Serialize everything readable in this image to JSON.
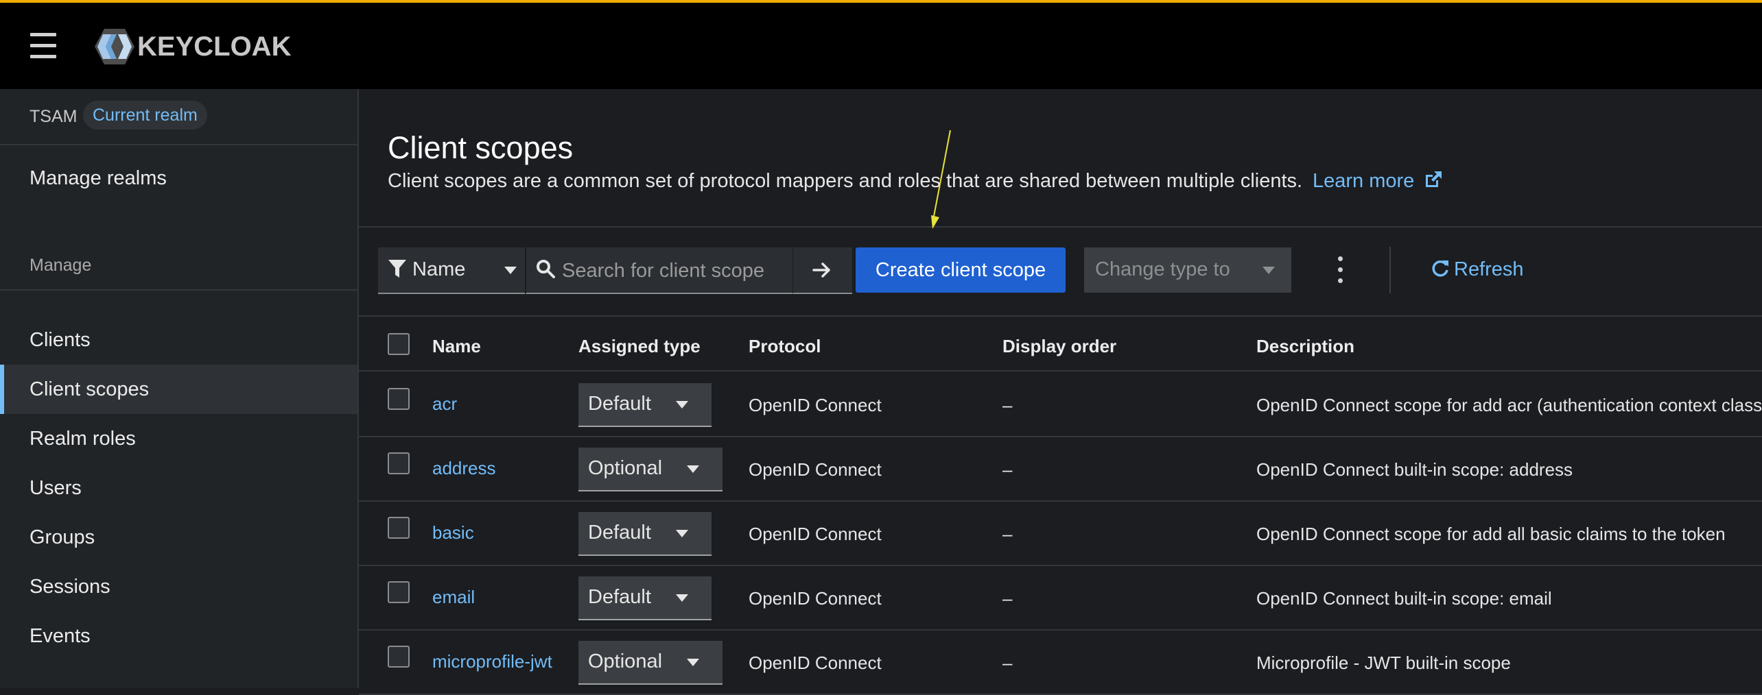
{
  "masthead": {
    "logo_text": "KEYCLOAK",
    "accent_color": "#f0ab00"
  },
  "sidebar": {
    "realm_name": "TSAM",
    "realm_badge": "Current realm",
    "manage_realms": "Manage realms",
    "section_label": "Manage",
    "items": [
      {
        "label": "Clients",
        "active": false
      },
      {
        "label": "Client scopes",
        "active": true
      },
      {
        "label": "Realm roles",
        "active": false
      },
      {
        "label": "Users",
        "active": false
      },
      {
        "label": "Groups",
        "active": false
      },
      {
        "label": "Sessions",
        "active": false
      },
      {
        "label": "Events",
        "active": false
      }
    ]
  },
  "page": {
    "title": "Client scopes",
    "description": "Client scopes are a common set of protocol mappers and roles that are shared between multiple clients.",
    "learn_more": "Learn more"
  },
  "toolbar": {
    "filter_label": "Name",
    "search_placeholder": "Search for client scope",
    "create_button": "Create client scope",
    "change_type": "Change type to",
    "refresh": "Refresh"
  },
  "table": {
    "columns": [
      "Name",
      "Assigned type",
      "Protocol",
      "Display order",
      "Description"
    ],
    "rows": [
      {
        "name": "acr",
        "type": "Default",
        "protocol": "OpenID Connect",
        "order": "–",
        "description": "OpenID Connect scope for add acr (authentication context class r"
      },
      {
        "name": "address",
        "type": "Optional",
        "protocol": "OpenID Connect",
        "order": "–",
        "description": "OpenID Connect built-in scope: address"
      },
      {
        "name": "basic",
        "type": "Default",
        "protocol": "OpenID Connect",
        "order": "–",
        "description": "OpenID Connect scope for add all basic claims to the token"
      },
      {
        "name": "email",
        "type": "Default",
        "protocol": "OpenID Connect",
        "order": "–",
        "description": "OpenID Connect built-in scope: email"
      },
      {
        "name": "microprofile-jwt",
        "type": "Optional",
        "protocol": "OpenID Connect",
        "order": "–",
        "description": "Microprofile - JWT built-in scope"
      }
    ]
  },
  "colors": {
    "link": "#73bcf7",
    "primary_button": "#1f61d1",
    "annotation_arrow": "#e8e23a"
  }
}
